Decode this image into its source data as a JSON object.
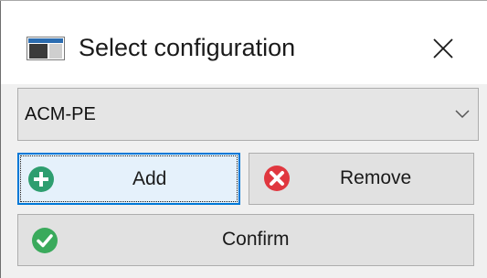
{
  "window": {
    "title": "Select configuration",
    "icon": "window-app-icon",
    "close_icon": "close-icon"
  },
  "configuration_select": {
    "selected_value": "ACM-PE",
    "chevron_icon": "chevron-down-icon"
  },
  "buttons": {
    "add": {
      "label": "Add",
      "icon": "plus-circle-icon",
      "icon_color": "#2e9e6f",
      "focused": true
    },
    "remove": {
      "label": "Remove",
      "icon": "x-circle-icon",
      "icon_color": "#e0373f"
    },
    "confirm": {
      "label": "Confirm",
      "icon": "check-circle-icon",
      "icon_color": "#3aaa5c"
    }
  },
  "colors": {
    "focus_accent": "#0078d7"
  }
}
